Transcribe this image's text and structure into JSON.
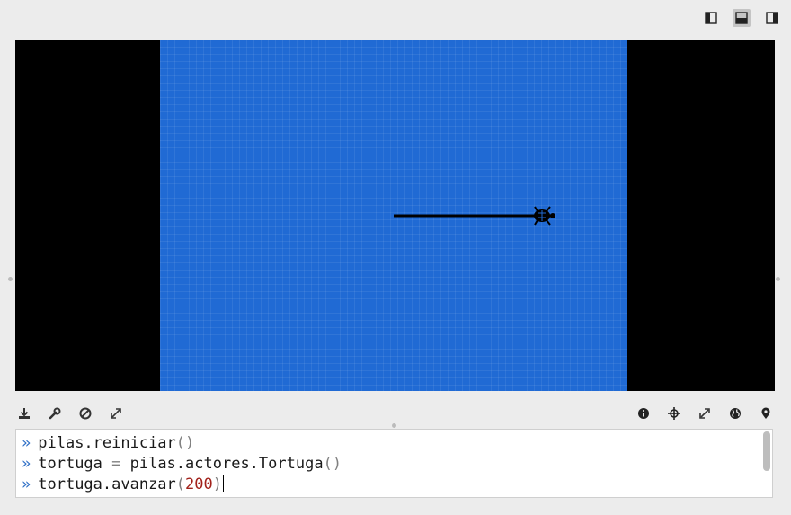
{
  "layout_buttons": [
    {
      "name": "layout-left-panel-icon",
      "active": false
    },
    {
      "name": "layout-bottom-panel-icon",
      "active": true
    },
    {
      "name": "layout-right-panel-icon",
      "active": false
    }
  ],
  "canvas": {
    "background": "#206ad4",
    "side_fill": "#000000"
  },
  "left_toolbar": [
    "download-icon",
    "wrench-icon",
    "no-entry-icon",
    "expand-icon"
  ],
  "right_toolbar": [
    "info-icon",
    "crosshair-icon",
    "expand-icon",
    "globe-icon",
    "map-pin-icon"
  ],
  "console": {
    "prompt": "»",
    "lines": [
      {
        "parts": [
          {
            "t": "pilas.reiniciar",
            "c": "#1a1a1a"
          },
          {
            "t": "()",
            "c": "#808080"
          }
        ]
      },
      {
        "parts": [
          {
            "t": "tortuga ",
            "c": "#1a1a1a"
          },
          {
            "t": "=",
            "c": "#808080"
          },
          {
            "t": " pilas.actores.Tortuga",
            "c": "#1a1a1a"
          },
          {
            "t": "()",
            "c": "#808080"
          }
        ]
      },
      {
        "parts": [
          {
            "t": "tortuga.avanzar",
            "c": "#1a1a1a"
          },
          {
            "t": "(",
            "c": "#808080"
          },
          {
            "t": "200",
            "c": "#a2221b"
          },
          {
            "t": ")",
            "c": "#808080"
          }
        ],
        "cursor": true
      }
    ]
  }
}
